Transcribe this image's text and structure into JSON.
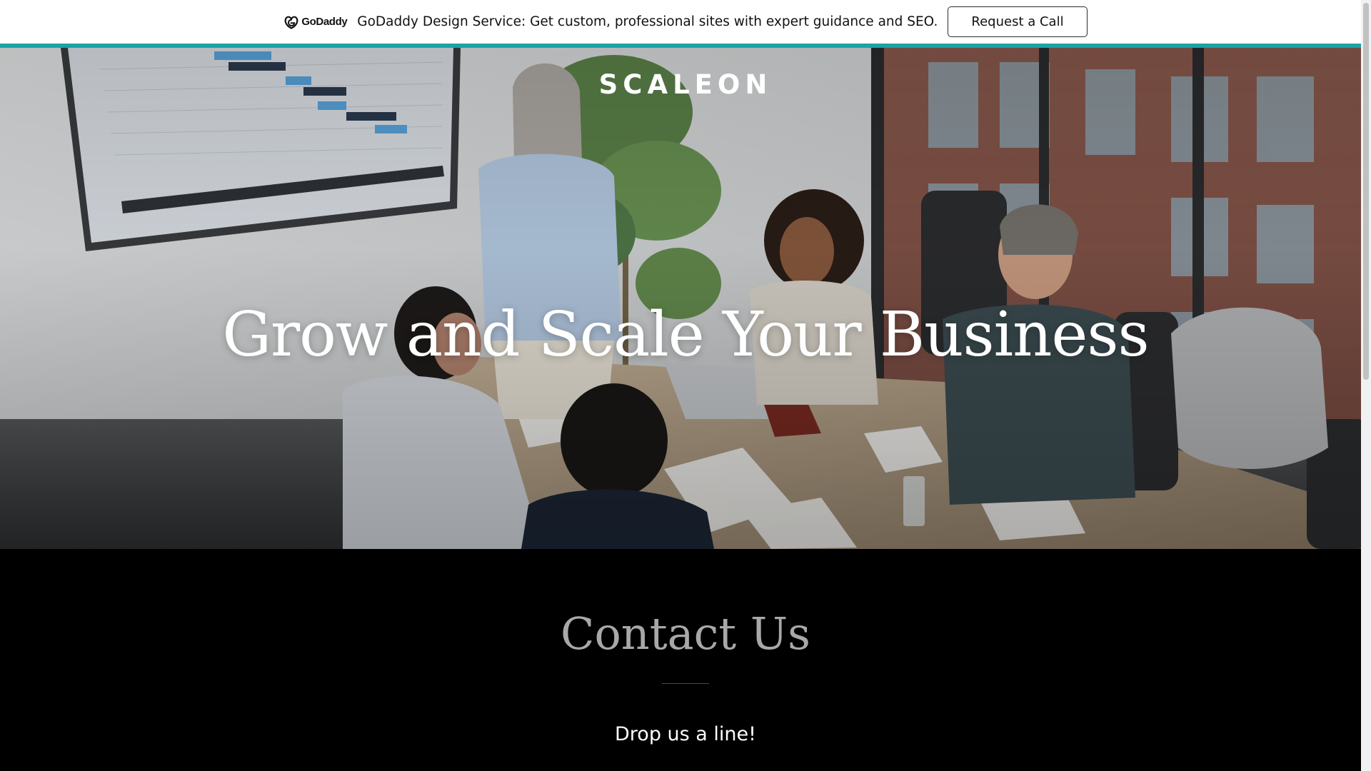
{
  "promo": {
    "logo_text": "GoDaddy",
    "message": "GoDaddy Design Service: Get custom, professional sites with expert guidance and SEO.",
    "cta_label": "Request a Call"
  },
  "hero": {
    "brand": "SCALEON",
    "title": "Grow and Scale Your Business",
    "photo_alt": "business-meeting-photo"
  },
  "contact": {
    "title": "Contact Us",
    "subtitle": "Drop us a line!"
  },
  "colors": {
    "accent": "#1ba3a6",
    "banner_bg": "#ffffff",
    "section_bg": "#000000",
    "contact_title": "#a8a8a8"
  },
  "icons": {
    "logo": "godaddy-logo-icon"
  }
}
